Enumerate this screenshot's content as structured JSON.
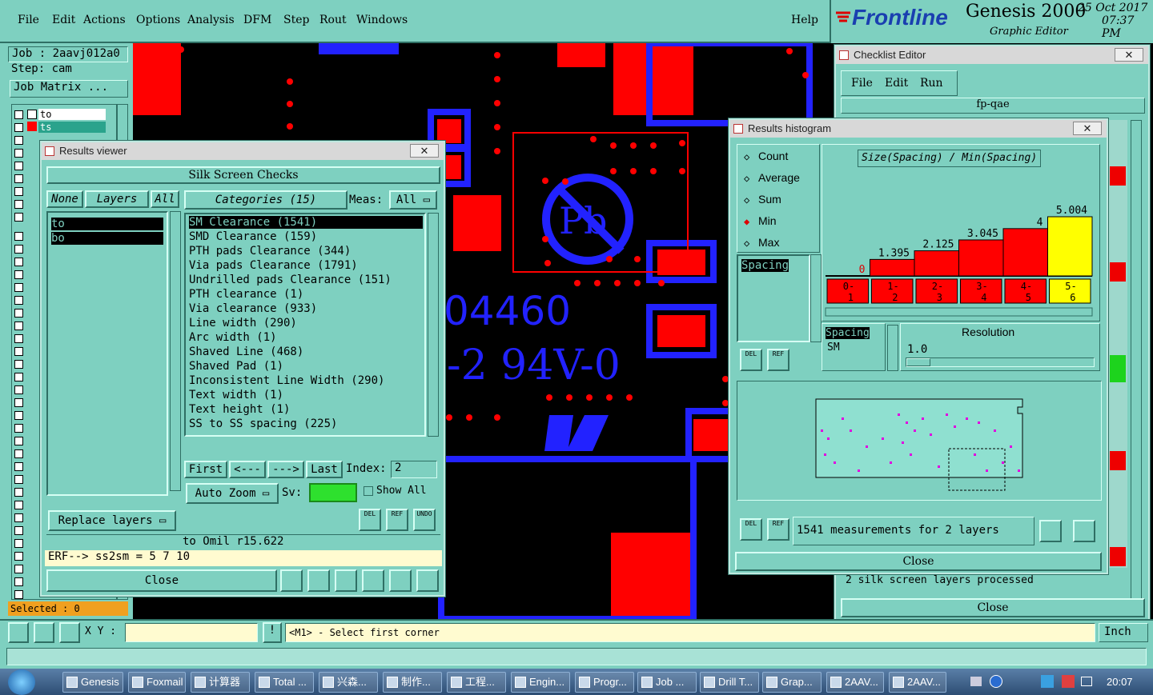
{
  "menubar": {
    "items": [
      "File",
      "Edit",
      "Actions",
      "Options",
      "Analysis",
      "DFM",
      "Step",
      "Rout",
      "Windows"
    ],
    "help": "Help"
  },
  "logo": {
    "brand": "Frontline",
    "product": "Genesis 2000",
    "subtitle": "Graphic Editor",
    "date": "25 Oct 2017",
    "time": "07:37 PM"
  },
  "left": {
    "job": "Job : 2aavj012a0",
    "step": "Step: cam",
    "matrix_button": "Job Matrix ...",
    "layers": [
      "to",
      "ts"
    ],
    "selected": "Selected : 0"
  },
  "pcb": {
    "text1": "04460",
    "text2": "-2 94V-0",
    "pb": "Pb"
  },
  "results_viewer": {
    "title": "Results viewer",
    "header": "Silk Screen Checks",
    "none": "None",
    "layers_label": "Layers",
    "all": "All",
    "layer_items": [
      "to",
      "bo"
    ],
    "categories_label": "Categories (15)",
    "meas_label": "Meas:",
    "meas_value": "All",
    "categories": [
      "SM Clearance (1541)",
      "SMD Clearance (159)",
      "PTH pads Clearance (344)",
      "Via pads Clearance (1791)",
      "Undrilled pads Clearance (151)",
      "PTH clearance (1)",
      "Via clearance (933)",
      "Line width (290)",
      "Arc width (1)",
      "Shaved Line (468)",
      "Shaved Pad (1)",
      "Inconsistent Line Width (290)",
      "Text width (1)",
      "Text height (1)",
      "SS to SS spacing (225)"
    ],
    "nav": {
      "first": "First",
      "prev": "<---",
      "next": "--->",
      "last": "Last",
      "index_label": "Index:",
      "index_value": "2"
    },
    "auto_zoom": "Auto Zoom",
    "sv_label": "Sv:",
    "show_all": "Show All",
    "replace_layers": "Replace layers",
    "measure_line": "to Omil  r15.622",
    "erf_line": "ERF--> ss2sm = 5 7 10",
    "close": "Close",
    "del": "DEL",
    "ref": "REF",
    "undo": "UNDO"
  },
  "checklist": {
    "title": "Checklist Editor",
    "menus": [
      "File",
      "Edit",
      "Run"
    ],
    "name": "fp-qae",
    "status_line": "2 silk screen layers processed",
    "close": "Close"
  },
  "histogram": {
    "title": "Results histogram",
    "radio": [
      "Count",
      "Average",
      "Sum",
      "Min",
      "Max"
    ],
    "selected_radio": "Min",
    "list_item": "Spacing",
    "chart_title": "Size(Spacing) / Min(Spacing)",
    "resolution_label": "Resolution",
    "resolution_value": "1.0",
    "spacing_label": "Spacing",
    "sm_label": "SM",
    "measurements": "1541 measurements for 2 layers",
    "close": "Close",
    "del": "DEL",
    "ref": "REF",
    "colors": {
      "bar": "#ff0000",
      "highlight": "#ffff00"
    }
  },
  "chart_data": {
    "type": "bar",
    "title": "Size(Spacing) / Min(Spacing)",
    "categories": [
      "0-1",
      "1-2",
      "2-3",
      "3-4",
      "4-5",
      "5-6"
    ],
    "values": [
      0,
      1.395,
      2.125,
      3.045,
      4,
      5.004
    ],
    "labels": [
      "0",
      "1.395",
      "2.125",
      "3.045",
      "4",
      "5.004"
    ]
  },
  "cmdbar": {
    "xy_label": "X Y :",
    "prompt": "<M1> - Select first corner",
    "units": "Inch"
  },
  "taskbar": {
    "items": [
      "Genesis",
      "Foxmail",
      "计算器",
      "Total ...",
      "兴森...",
      "制作...",
      "工程...",
      "Engin...",
      "Progr...",
      "Job ...",
      "Drill T...",
      "Grap...",
      "2AAV...",
      "2AAV..."
    ],
    "clock": "20:07"
  }
}
